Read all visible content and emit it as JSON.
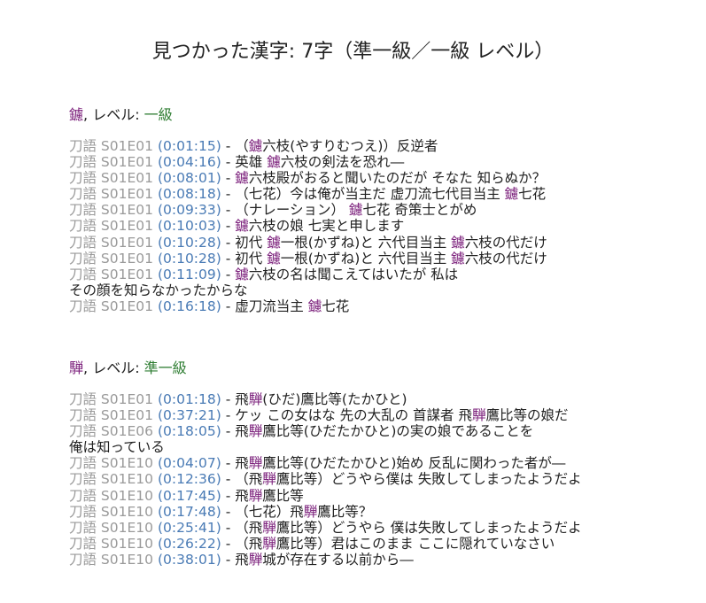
{
  "title": "見つかった漢字: 7字（準一級／一級 レベル）",
  "colors": {
    "kanji": "#7b1f7b",
    "level": "#2e7d32",
    "source": "#9a9a9a",
    "timestamp": "#4a7bb5"
  },
  "sections": [
    {
      "kanji": "鑢",
      "level_prefix": ", レベル: ",
      "level": "一級",
      "lines": [
        {
          "source": "刀語 S01E01",
          "time": "(0:01:15)",
          "sep": " - ",
          "parts": [
            "（",
            "鑢",
            "六枝(やすりむつえ)）反逆者"
          ]
        },
        {
          "source": "刀語 S01E01",
          "time": "(0:04:16)",
          "sep": " - ",
          "parts": [
            "英雄 ",
            "鑢",
            "六枝の剣法を恐れ―"
          ]
        },
        {
          "source": "刀語 S01E01",
          "time": "(0:08:01)",
          "sep": " - ",
          "parts": [
            "",
            "鑢",
            "六枝殿がおると聞いたのだが そなた 知らぬか？"
          ]
        },
        {
          "source": "刀語 S01E01",
          "time": "(0:08:18)",
          "sep": " - ",
          "parts": [
            "（七花）今は俺が当主だ 虚刀流七代目当主 ",
            "鑢",
            "七花"
          ]
        },
        {
          "source": "刀語 S01E01",
          "time": "(0:09:33)",
          "sep": " - ",
          "parts": [
            "（ナレーション） ",
            "鑢",
            "七花 奇策士とがめ"
          ]
        },
        {
          "source": "刀語 S01E01",
          "time": "(0:10:03)",
          "sep": " - ",
          "parts": [
            "",
            "鑢",
            "六枝の娘 七実と申します"
          ]
        },
        {
          "source": "刀語 S01E01",
          "time": "(0:10:28)",
          "sep": " - ",
          "parts": [
            "初代 ",
            "鑢",
            "一根(かずね)と 六代目当主 ",
            "鑢",
            "六枝の代だけ"
          ]
        },
        {
          "source": "刀語 S01E01",
          "time": "(0:10:28)",
          "sep": " - ",
          "parts": [
            "初代 ",
            "鑢",
            "一根(かずね)と 六代目当主 ",
            "鑢",
            "六枝の代だけ"
          ]
        },
        {
          "source": "刀語 S01E01",
          "time": "(0:11:09)",
          "sep": " - ",
          "parts": [
            "",
            "鑢",
            "六枝の名は聞こえてはいたが 私は"
          ]
        },
        {
          "continuation": "その顔を知らなかったからな"
        },
        {
          "source": "刀語 S01E01",
          "time": "(0:16:18)",
          "sep": " - ",
          "parts": [
            "虚刀流当主 ",
            "鑢",
            "七花"
          ]
        }
      ]
    },
    {
      "kanji": "騨",
      "level_prefix": ", レベル: ",
      "level": "準一級",
      "lines": [
        {
          "source": "刀語 S01E01",
          "time": "(0:01:18)",
          "sep": " - ",
          "parts": [
            "飛",
            "騨",
            "(ひだ)鷹比等(たかひと)"
          ]
        },
        {
          "source": "刀語 S01E01",
          "time": "(0:37:21)",
          "sep": " - ",
          "parts": [
            "ケッ この女はな 先の大乱の 首謀者 飛",
            "騨",
            "鷹比等の娘だ"
          ]
        },
        {
          "source": "刀語 S01E06",
          "time": "(0:18:05)",
          "sep": " - ",
          "parts": [
            "飛",
            "騨",
            "鷹比等(ひだたかひと)の実の娘であることを"
          ]
        },
        {
          "continuation": "俺は知っている"
        },
        {
          "source": "刀語 S01E10",
          "time": "(0:04:07)",
          "sep": " - ",
          "parts": [
            "飛",
            "騨",
            "鷹比等(ひだたかひと)始め 反乱に関わった者が―"
          ]
        },
        {
          "source": "刀語 S01E10",
          "time": "(0:12:36)",
          "sep": " - ",
          "parts": [
            "（飛",
            "騨",
            "鷹比等）どうやら僕は 失敗してしまったようだよ"
          ]
        },
        {
          "source": "刀語 S01E10",
          "time": "(0:17:45)",
          "sep": " - ",
          "parts": [
            "飛",
            "騨",
            "鷹比等"
          ]
        },
        {
          "source": "刀語 S01E10",
          "time": "(0:17:48)",
          "sep": " - ",
          "parts": [
            "（七花）飛",
            "騨",
            "鷹比等？"
          ]
        },
        {
          "source": "刀語 S01E10",
          "time": "(0:25:41)",
          "sep": " - ",
          "parts": [
            "（飛",
            "騨",
            "鷹比等）どうやら 僕は失敗してしまったようだよ"
          ]
        },
        {
          "source": "刀語 S01E10",
          "time": "(0:26:22)",
          "sep": " - ",
          "parts": [
            "（飛",
            "騨",
            "鷹比等）君はこのまま ここに隠れていなさい"
          ]
        },
        {
          "source": "刀語 S01E10",
          "time": "(0:38:01)",
          "sep": " - ",
          "parts": [
            "飛",
            "騨",
            "城が存在する以前から―"
          ]
        }
      ]
    }
  ]
}
